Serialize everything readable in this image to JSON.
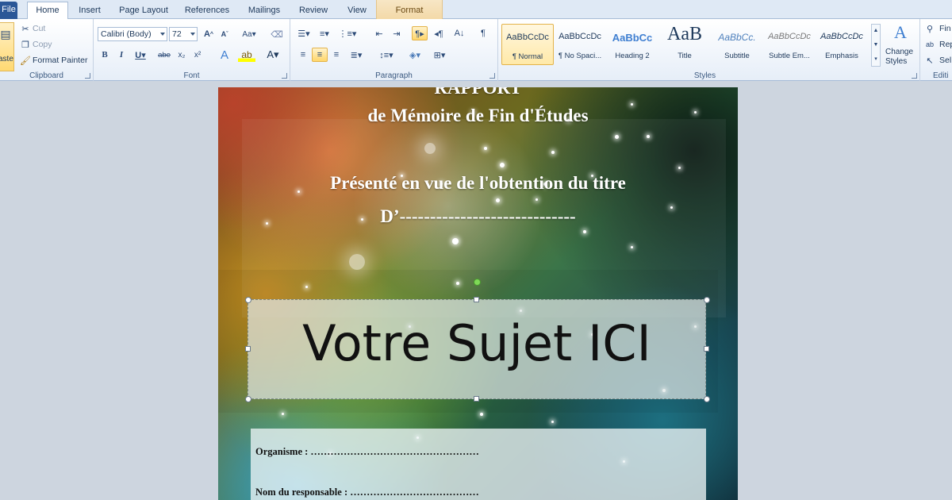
{
  "tabs": {
    "file": "File",
    "home": "Home",
    "insert": "Insert",
    "page_layout": "Page Layout",
    "references": "References",
    "mailings": "Mailings",
    "review": "Review",
    "view": "View",
    "format": "Format"
  },
  "clipboard": {
    "paste": "aste",
    "cut": "Cut",
    "copy": "Copy",
    "format_painter": "Format Painter",
    "label": "Clipboard"
  },
  "font": {
    "name": "Calibri (Body)",
    "size": "72",
    "label": "Font"
  },
  "paragraph": {
    "label": "Paragraph"
  },
  "styles": {
    "label": "Styles",
    "items": [
      {
        "sample": "AaBbCcDc",
        "name": "¶ Normal"
      },
      {
        "sample": "AaBbCcDc",
        "name": "¶ No Spaci..."
      },
      {
        "sample": "AaBbCc",
        "name": "Heading 2"
      },
      {
        "sample": "AaB",
        "name": "Title"
      },
      {
        "sample": "AaBbCc.",
        "name": "Subtitle"
      },
      {
        "sample": "AaBbCcDc",
        "name": "Subtle Em..."
      },
      {
        "sample": "AaBbCcDc",
        "name": "Emphasis"
      }
    ],
    "change_styles_line1": "Change",
    "change_styles_line2": "Styles"
  },
  "editing": {
    "find": "Fin",
    "replace": "Rep",
    "select": "Sel",
    "label": "Editi"
  },
  "document": {
    "line_top": "RAPPORT",
    "line_memoire": "de Mémoire de Fin d'Études",
    "line_presente": "Présenté en vue de l'obtention du titre",
    "line_d": "D’-----------------------------",
    "subject": "Votre Sujet ICI",
    "organisme": "Organisme : ……………………………………………",
    "responsable": "Nom du responsable : …………………………………"
  },
  "colors": {
    "ribbon_accent": "#2b5797",
    "selected_style": "#ffe9a8",
    "format_tab": "#f3d9a8"
  }
}
